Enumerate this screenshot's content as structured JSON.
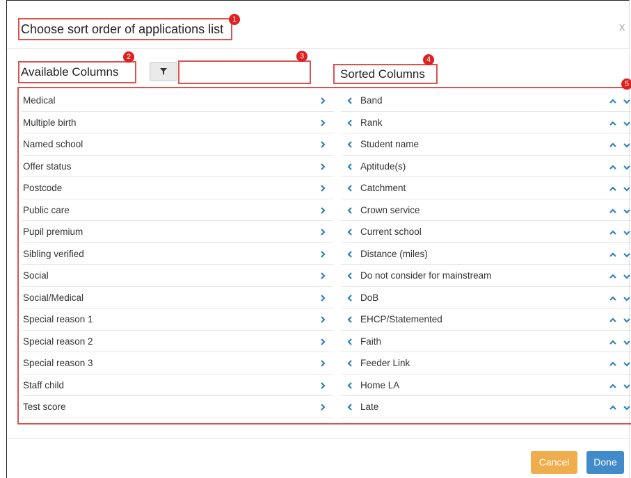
{
  "dialog": {
    "title": "Choose sort order of applications list",
    "close_label": "x"
  },
  "available": {
    "header": "Available Columns",
    "filter_value": "",
    "items": [
      {
        "label": "Medical"
      },
      {
        "label": "Multiple birth"
      },
      {
        "label": "Named school"
      },
      {
        "label": "Offer status"
      },
      {
        "label": "Postcode"
      },
      {
        "label": "Public care"
      },
      {
        "label": "Pupil premium"
      },
      {
        "label": "Sibling verified"
      },
      {
        "label": "Social"
      },
      {
        "label": "Social/Medical"
      },
      {
        "label": "Special reason 1"
      },
      {
        "label": "Special reason 2"
      },
      {
        "label": "Special reason 3"
      },
      {
        "label": "Staff child"
      },
      {
        "label": "Test score"
      }
    ]
  },
  "sorted": {
    "header": "Sorted Columns",
    "items": [
      {
        "label": "Band"
      },
      {
        "label": "Rank"
      },
      {
        "label": "Student name"
      },
      {
        "label": "Aptitude(s)"
      },
      {
        "label": "Catchment"
      },
      {
        "label": "Crown service"
      },
      {
        "label": "Current school"
      },
      {
        "label": "Distance (miles)"
      },
      {
        "label": "Do not consider for mainstream"
      },
      {
        "label": "DoB"
      },
      {
        "label": "EHCP/Statemented"
      },
      {
        "label": "Faith"
      },
      {
        "label": "Feeder Link"
      },
      {
        "label": "Home LA"
      },
      {
        "label": "Late"
      }
    ]
  },
  "annotations": [
    "1",
    "2",
    "3",
    "4",
    "5"
  ],
  "footer": {
    "cancel_label": "Cancel",
    "done_label": "Done"
  },
  "icons": {
    "filter": "filter-icon",
    "move_right": "chevron-right-icon",
    "move_left": "chevron-left-icon",
    "move_up": "chevron-up-icon",
    "move_down": "chevron-down-icon"
  },
  "colors": {
    "annotation_red": "#d9534f",
    "badge_red": "#e02020",
    "arrow_blue": "#2f7fc1",
    "cancel_orange": "#f0ad4e",
    "done_blue": "#428bca"
  }
}
